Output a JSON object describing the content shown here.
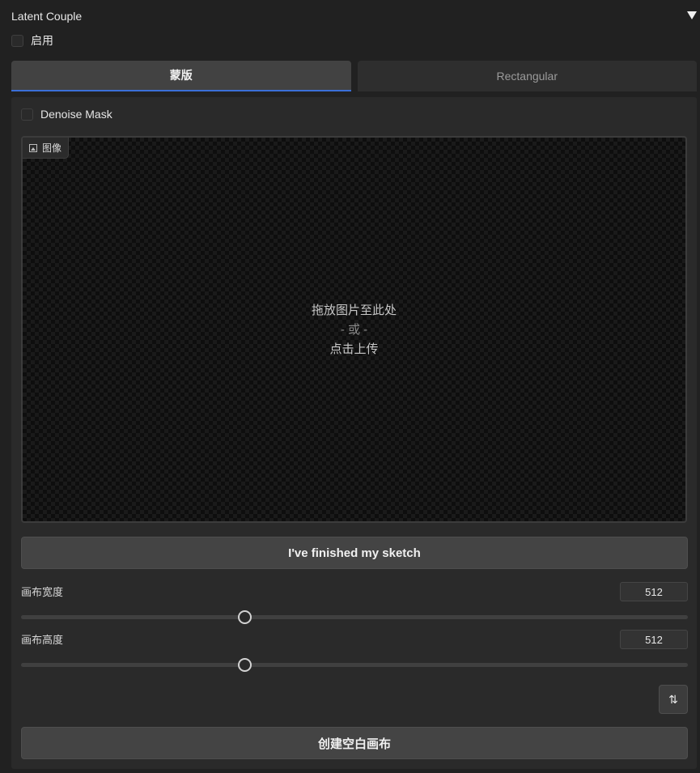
{
  "accordion": {
    "title": "Latent Couple",
    "enable_label": "启用"
  },
  "tabs": [
    {
      "label": "蒙版",
      "active": true
    },
    {
      "label": "Rectangular",
      "active": false
    }
  ],
  "panel": {
    "denoise_label": "Denoise Mask",
    "image": {
      "label": "图像",
      "drop_line1": "拖放图片至此处",
      "drop_or": "- 或 -",
      "drop_line2": "点击上传"
    },
    "finish_button": "I've finished my sketch",
    "width": {
      "label": "画布宽度",
      "value": "512",
      "fraction": 0.335
    },
    "height": {
      "label": "画布高度",
      "value": "512",
      "fraction": 0.335
    },
    "swap_icon": "⇅",
    "create_button": "创建空白画布"
  },
  "colors": {
    "accent": "#3b6fd8",
    "background": "#212121",
    "panel": "#2a2a2a"
  },
  "icons": [
    "chevron-down-icon",
    "image-icon",
    "swap-icon"
  ]
}
